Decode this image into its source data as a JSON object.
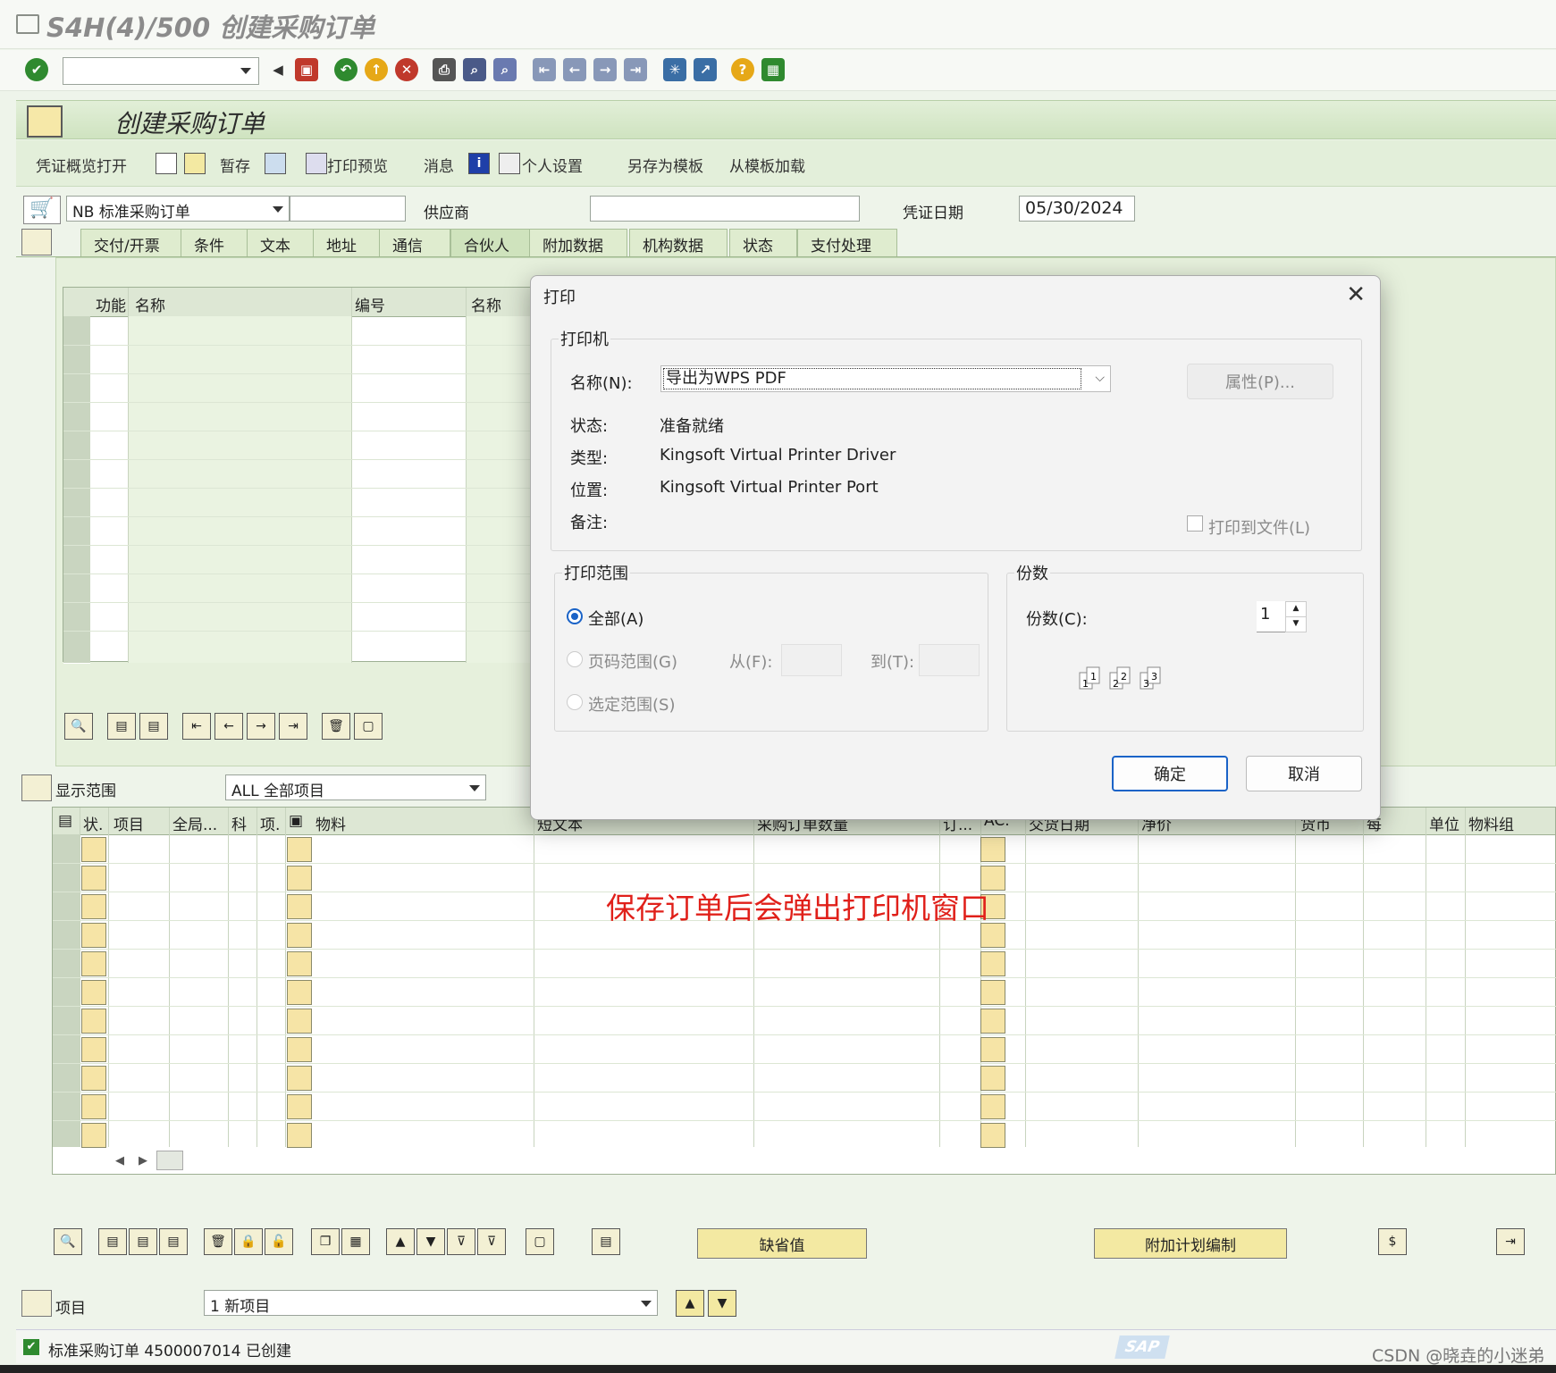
{
  "window": {
    "title": "S4H(4)/500 创建采购订单"
  },
  "app": {
    "title": "创建采购订单",
    "menu": {
      "overview_open": "凭证概览打开",
      "hold": "暂存",
      "print_preview": "打印预览",
      "messages": "消息",
      "personal_settings": "个人设置",
      "save_as_template": "另存为模板",
      "load_from_template": "从模板加载"
    }
  },
  "header": {
    "doc_type": "NB 标准采购订单",
    "supplier_label": "供应商",
    "supplier_value": "",
    "date_label": "凭证日期",
    "date_value": "05/30/2024"
  },
  "tabs": [
    "交付/开票",
    "条件",
    "文本",
    "地址",
    "通信",
    "合伙人",
    "附加数据",
    "机构数据",
    "状态",
    "支付处理"
  ],
  "partner_table": {
    "columns": [
      "功能",
      "名称",
      "编号",
      "名称"
    ]
  },
  "items_section": {
    "display_range_label": "显示范围",
    "display_range_value": "ALL 全部项目",
    "columns": [
      "状.",
      "项目",
      "全局...",
      "科",
      "项.",
      "物料",
      "短文本",
      "采购订单数量",
      "订...",
      "AC.",
      "交货日期",
      "净价",
      "货币",
      "每",
      "单位",
      "物料组"
    ],
    "default_button": "缺省值",
    "schedule_button": "附加计划编制"
  },
  "item_nav": {
    "label": "项目",
    "value": "1 新项目"
  },
  "status": {
    "message": "标准采购订单 4500007014 已创建"
  },
  "annotation": "保存订单后会弹出打印机窗口",
  "watermark": "CSDN @晓垚的小迷弟",
  "print_dialog": {
    "title": "打印",
    "printer_group": "打印机",
    "name_label": "名称(N):",
    "name_value": "导出为WPS PDF",
    "properties_button": "属性(P)...",
    "status_label": "状态:",
    "status_value": "准备就绪",
    "type_label": "类型:",
    "type_value": "Kingsoft Virtual Printer Driver",
    "location_label": "位置:",
    "location_value": "Kingsoft Virtual Printer Port",
    "comment_label": "备注:",
    "print_to_file": "打印到文件(L)",
    "range_group": "打印范围",
    "range_all": "全部(A)",
    "range_pages": "页码范围(G)",
    "from_label": "从(F):",
    "to_label": "到(T):",
    "range_selection": "选定范围(S)",
    "copies_group": "份数",
    "copies_label": "份数(C):",
    "copies_value": "1",
    "ok_button": "确定",
    "cancel_button": "取消"
  },
  "colors": {
    "sap_green": "#cfe3c0",
    "yellow_cell": "#f6e4a6",
    "annotation_red": "#e0201a",
    "radio_blue": "#1a63c7"
  }
}
